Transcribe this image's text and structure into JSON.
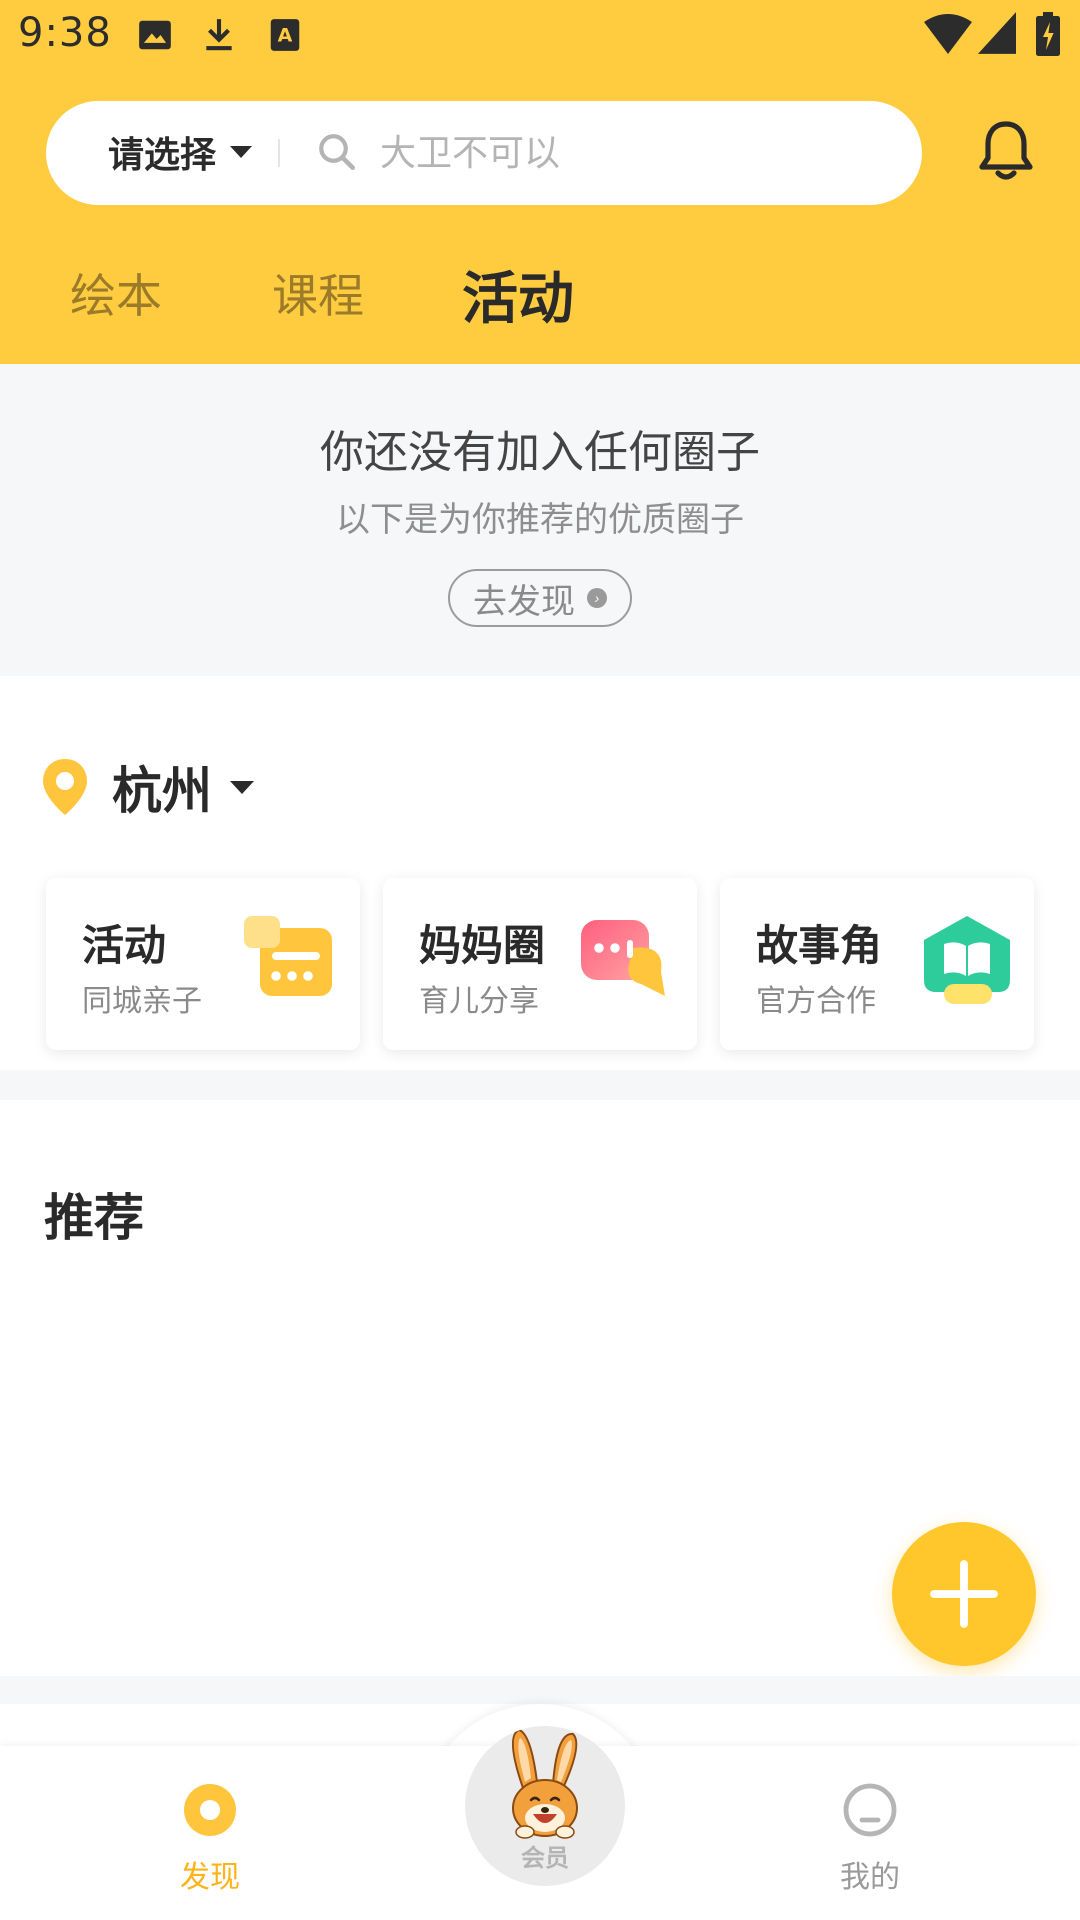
{
  "status_bar": {
    "time": "9:38"
  },
  "search": {
    "city_select_label": "请选择",
    "placeholder": "大卫不可以"
  },
  "tabs": [
    {
      "label": "绘本",
      "active": false
    },
    {
      "label": "课程",
      "active": false
    },
    {
      "label": "活动",
      "active": true
    }
  ],
  "circles_notice": {
    "title": "你还没有加入任何圈子",
    "subtitle": "以下是为你推荐的优质圈子",
    "button_label": "去发现"
  },
  "location": {
    "city": "杭州"
  },
  "categories": [
    {
      "title": "活动",
      "subtitle": "同城亲子",
      "icon": "calendar-icon",
      "color": "#FFC53D"
    },
    {
      "title": "妈妈圈",
      "subtitle": "育儿分享",
      "icon": "chat-bubble-icon",
      "color": "#FF6F8C"
    },
    {
      "title": "故事角",
      "subtitle": "官方合作",
      "icon": "book-icon",
      "color": "#2ECC9A"
    }
  ],
  "recommend": {
    "title": "推荐"
  },
  "bottom_nav": [
    {
      "label": "发现",
      "icon": "discover-icon",
      "active": true
    },
    {
      "label": "会员",
      "icon": "rabbit-mascot-icon",
      "active": false
    },
    {
      "label": "我的",
      "icon": "profile-icon",
      "active": false
    }
  ],
  "colors": {
    "brand_yellow": "#FFCC40",
    "accent": "#FFC72C",
    "background_gray": "#F6F7F9"
  }
}
